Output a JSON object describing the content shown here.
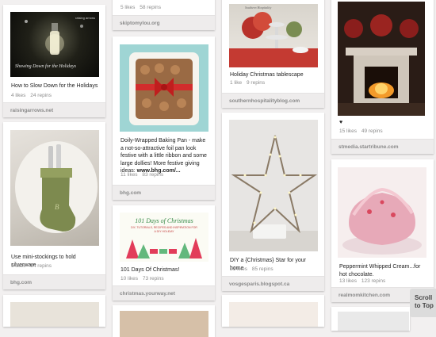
{
  "pins": [
    {
      "id": "slow-down",
      "description": "How to Slow Down for the Holidays",
      "likes": "4 likes",
      "repins": "24 repins",
      "source": "raisingarrows.net",
      "image_text": "Showing Down for the Holidays",
      "image_logo": "raising arrows"
    },
    {
      "id": "mini-stockings",
      "description": "Use mini-stockings to hold silverware",
      "likes": "6 likes",
      "repins": "84 repins",
      "source": "bhg.com"
    },
    {
      "id": "top-partial",
      "likes": "5 likes",
      "repins": "58 repins",
      "source": "skiptomylou.org"
    },
    {
      "id": "baking-pan",
      "description": "Doily-Wrapped Baking Pan - make a not-so-attractive foil pan look festive with a little ribbon and some large dollies! More festive giving ideas:",
      "link": "www.bhg.com/...",
      "likes": "11 likes",
      "repins": "83 repins",
      "source": "bhg.com"
    },
    {
      "id": "101-days",
      "description": "101 Days Of Christmas!",
      "likes": "10 likes",
      "repins": "73 repins",
      "source": "christmas.yourway.net",
      "image_title": "101 Days of Christmas",
      "image_subtitle": "DIY, TUTORIALS, RECIPES AND INSPIRATION FOR A DIY HOLIDAY"
    },
    {
      "id": "tablescape",
      "description": "Holiday Christmas tablescape",
      "likes": "1 like",
      "repins": "9 repins",
      "source": "southernhospitalityblog.com",
      "image_logo": "Southern Hospitality"
    },
    {
      "id": "star",
      "description": "DIY a {Christmas} Star for your home",
      "likes": "21 likes",
      "repins": "85 repins",
      "source": "vosgesparis.blogspot.ca"
    },
    {
      "id": "fireplace",
      "description": "♥",
      "likes": "15 likes",
      "repins": "49 repins",
      "source": "stmedia.startribune.com"
    },
    {
      "id": "peppermint",
      "description": "Peppermint Whipped Cream...for hot chocolate.",
      "likes": "13 likes",
      "repins": "123 repins",
      "source": "realmomkitchen.com"
    }
  ],
  "scroll_to_top": {
    "line1": "Scroll",
    "line2": "to Top"
  }
}
